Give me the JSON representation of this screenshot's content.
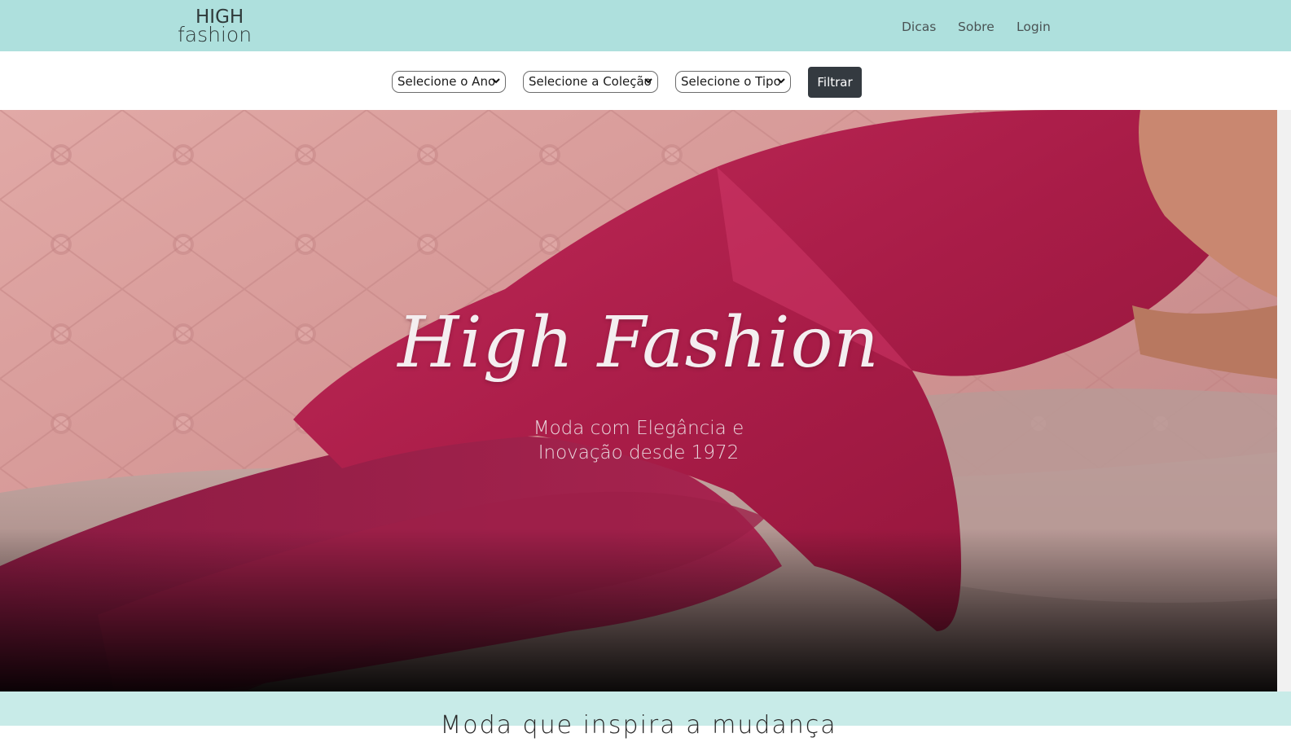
{
  "brand": {
    "logo_line1": "HIGH",
    "logo_line2": "fashion"
  },
  "nav": {
    "items": [
      {
        "label": "Dicas"
      },
      {
        "label": "Sobre"
      },
      {
        "label": "Login"
      }
    ]
  },
  "filters": {
    "year_select": "Selecione o Ano",
    "collection_select": "Selecione a Coleção",
    "type_select": "Selecione o Tipo",
    "filter_button": "Filtrar"
  },
  "hero": {
    "title": "High Fashion",
    "subtitle_line1": "Moda com Elegância e",
    "subtitle_line2": "Inovação desde 1972"
  },
  "section": {
    "heading_partial": "Moda que inspira a mudança"
  },
  "colors": {
    "navbar_bg": "#aee0dd",
    "button_bg": "#343a40",
    "dress": "#b8234f",
    "sofa": "#d59a9a",
    "bottom_band": "#c8ebe8"
  }
}
